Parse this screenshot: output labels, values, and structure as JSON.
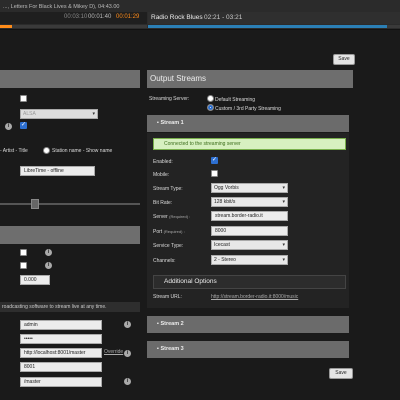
{
  "player": {
    "now_playing": "..., Letters For Black Lives & Mikey D), 04:43.00",
    "time_elapsed": "00:03:10",
    "time_current": "00:01:40",
    "time_remaining": "00:01:29",
    "show_name": "Radio Rock Blues",
    "show_range": "02:21 - 03:21",
    "track_progress": 0.08,
    "show_progress": 0.95
  },
  "top_save_label": "Save",
  "left": {
    "alsa_value": "ALSA",
    "metadata_format_text": "- Artist - Title",
    "station_show_option": "Station name - Show name",
    "offline_value": "LibreTime - offline",
    "slider_value": 0.25,
    "numeric_value": "0.000",
    "broadcast_note": "roadcasting software to stream live at any time.",
    "username_value": "admin",
    "password_value": "•••••",
    "master_url_value": "http://localhost:8001/master",
    "override_label": "Override",
    "port_value": "8001",
    "mount_value": "/master"
  },
  "output": {
    "title": "Output Streams",
    "server_label": "Streaming Server:",
    "server_default": "Default Streaming",
    "server_custom": "Custom / 3rd Party Streaming",
    "stream1": {
      "title": "Stream 1",
      "status": "Connected to the streaming server",
      "enabled_label": "Enabled:",
      "mobile_label": "Mobile:",
      "type_label": "Stream Type:",
      "type_value": "Ogg Vorbis",
      "bitrate_label": "Bit Rate:",
      "bitrate_value": "128 kbit/s",
      "server_label": "Server",
      "server_req": "(Required) :",
      "server_value": "stream.border-radio.it",
      "port_label": "Port",
      "port_req": "(Required) :",
      "port_value": "8000",
      "service_label": "Service Type:",
      "service_value": "Icecast",
      "channels_label": "Channels:",
      "channels_value": "2 - Stereo",
      "additional": "Additional Options",
      "url_label": "Stream URL:",
      "url_value": "http://stream.border-radio.it:8000/music"
    },
    "stream2_title": "Stream 2",
    "stream3_title": "Stream 3",
    "save_label": "Save"
  }
}
